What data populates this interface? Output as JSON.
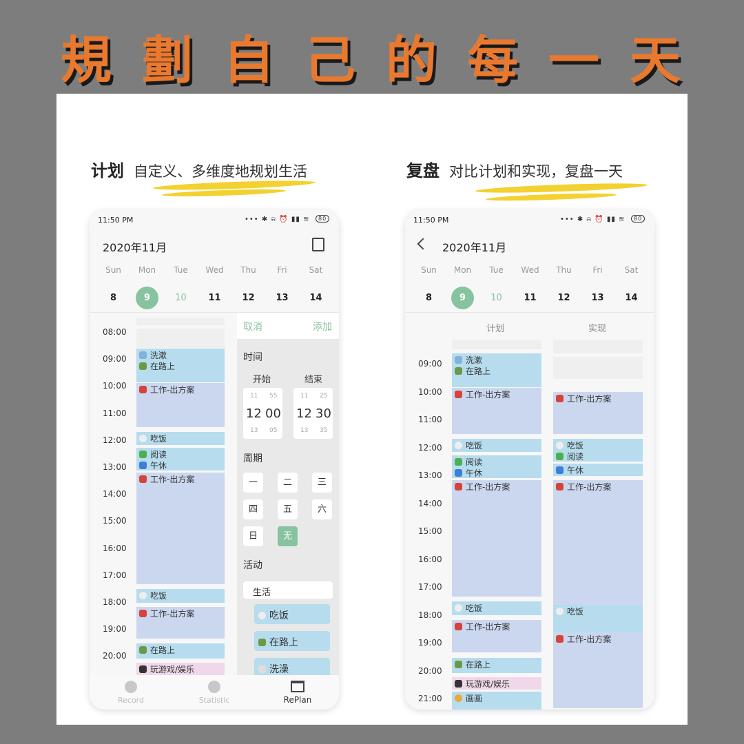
{
  "banner": "規劃自己的每一天",
  "left_caption": {
    "title": "计划",
    "subtitle": "自定义、多维度地规划生活"
  },
  "right_caption": {
    "title": "复盘",
    "subtitle": "对比计划和实现，复盘一天"
  },
  "status": {
    "time": "11:50 PM",
    "icons": "••• ✱ ⍾ ⏰ ▮▮ ≋",
    "battery": "80"
  },
  "month": "2020年11月",
  "weekdays": [
    "Sun",
    "Mon",
    "Tue",
    "Wed",
    "Thu",
    "Fri",
    "Sat"
  ],
  "dates": [
    "8",
    "9",
    "10",
    "11",
    "12",
    "13",
    "14"
  ],
  "selected_date": "9",
  "colors": {
    "accent": "#86c39e",
    "event_blue": "#b7dcee",
    "event_lavender": "#cbd7ef",
    "event_pink": "#f1d7ea",
    "banner": "#e8792f",
    "brush": "#f3d130"
  },
  "left": {
    "hours": [
      "08:00",
      "09:00",
      "10:00",
      "11:00",
      "12:00",
      "13:00",
      "14:00",
      "15:00",
      "16:00",
      "17:00",
      "18:00",
      "19:00",
      "20:00"
    ],
    "events": [
      {
        "lines": [
          "洗漱",
          "在路上"
        ],
        "icons": [
          "shower-icon",
          "walking-icon"
        ]
      },
      {
        "lines": [
          "工作-出方案"
        ],
        "icons": [
          "santa-icon"
        ]
      },
      {
        "lines": [
          "吃饭"
        ],
        "icons": [
          "rice-icon"
        ]
      },
      {
        "lines": [
          "阅读",
          "午休"
        ],
        "icons": [
          "clover-icon",
          "sleep-icon"
        ]
      },
      {
        "lines": [
          "工作-出方案"
        ],
        "icons": [
          "santa-icon"
        ]
      },
      {
        "lines": [
          "吃饭"
        ],
        "icons": [
          "rice-icon"
        ]
      },
      {
        "lines": [
          "工作-出方案"
        ],
        "icons": [
          "santa-icon"
        ]
      },
      {
        "lines": [
          "在路上"
        ],
        "icons": [
          "walking-icon"
        ]
      },
      {
        "lines": [
          "玩游戏/娱乐"
        ],
        "icons": [
          "gamepad-icon"
        ]
      }
    ],
    "panel": {
      "cancel": "取消",
      "add": "添加",
      "time_label": "时间",
      "start_label": "开始",
      "end_label": "结束",
      "start": {
        "hour_prev": "11",
        "min_prev": "55",
        "hour": "12",
        "min": "00",
        "hour_next": "13",
        "min_next": "05"
      },
      "end": {
        "hour_prev": "11",
        "min_prev": "25",
        "hour": "12",
        "min": "30",
        "hour_next": "13",
        "min_next": "35"
      },
      "cycle_label": "周期",
      "cycle_options": [
        "一",
        "二",
        "三",
        "四",
        "五",
        "六",
        "日",
        "无"
      ],
      "cycle_selected": "无",
      "activity_label": "活动",
      "category": "生活",
      "activities": [
        "吃饭",
        "在路上",
        "洗澡"
      ]
    },
    "nav": [
      {
        "label": "Record",
        "icon": "gauge-icon"
      },
      {
        "label": "Statistic",
        "icon": "pie-chart-icon"
      },
      {
        "label": "RePlan",
        "icon": "list-card-icon",
        "active": true
      }
    ]
  },
  "right": {
    "col_plan": "计划",
    "col_actual": "实现",
    "hours": [
      "09:00",
      "10:00",
      "11:00",
      "12:00",
      "13:00",
      "14:00",
      "15:00",
      "16:00",
      "17:00",
      "18:00",
      "19:00",
      "20:00",
      "21:00"
    ],
    "plan": [
      {
        "lines": [
          "洗漱",
          "在路上"
        ]
      },
      {
        "lines": [
          "工作-出方案"
        ]
      },
      {
        "lines": [
          "吃饭"
        ]
      },
      {
        "lines": [
          "阅读",
          "午休"
        ]
      },
      {
        "lines": [
          "工作-出方案"
        ]
      },
      {
        "lines": [
          "吃饭"
        ]
      },
      {
        "lines": [
          "工作-出方案"
        ]
      },
      {
        "lines": [
          "在路上"
        ]
      },
      {
        "lines": [
          "玩游戏/娱乐"
        ]
      },
      {
        "lines": [
          "画画"
        ]
      }
    ],
    "actual": [
      {
        "lines": [
          "工作-出方案"
        ]
      },
      {
        "lines": [
          "吃饭",
          "阅读"
        ]
      },
      {
        "lines": [
          "午休"
        ]
      },
      {
        "lines": [
          "工作-出方案"
        ]
      },
      {
        "lines": [
          "吃饭"
        ]
      },
      {
        "lines": [
          "工作-出方案"
        ]
      }
    ]
  }
}
